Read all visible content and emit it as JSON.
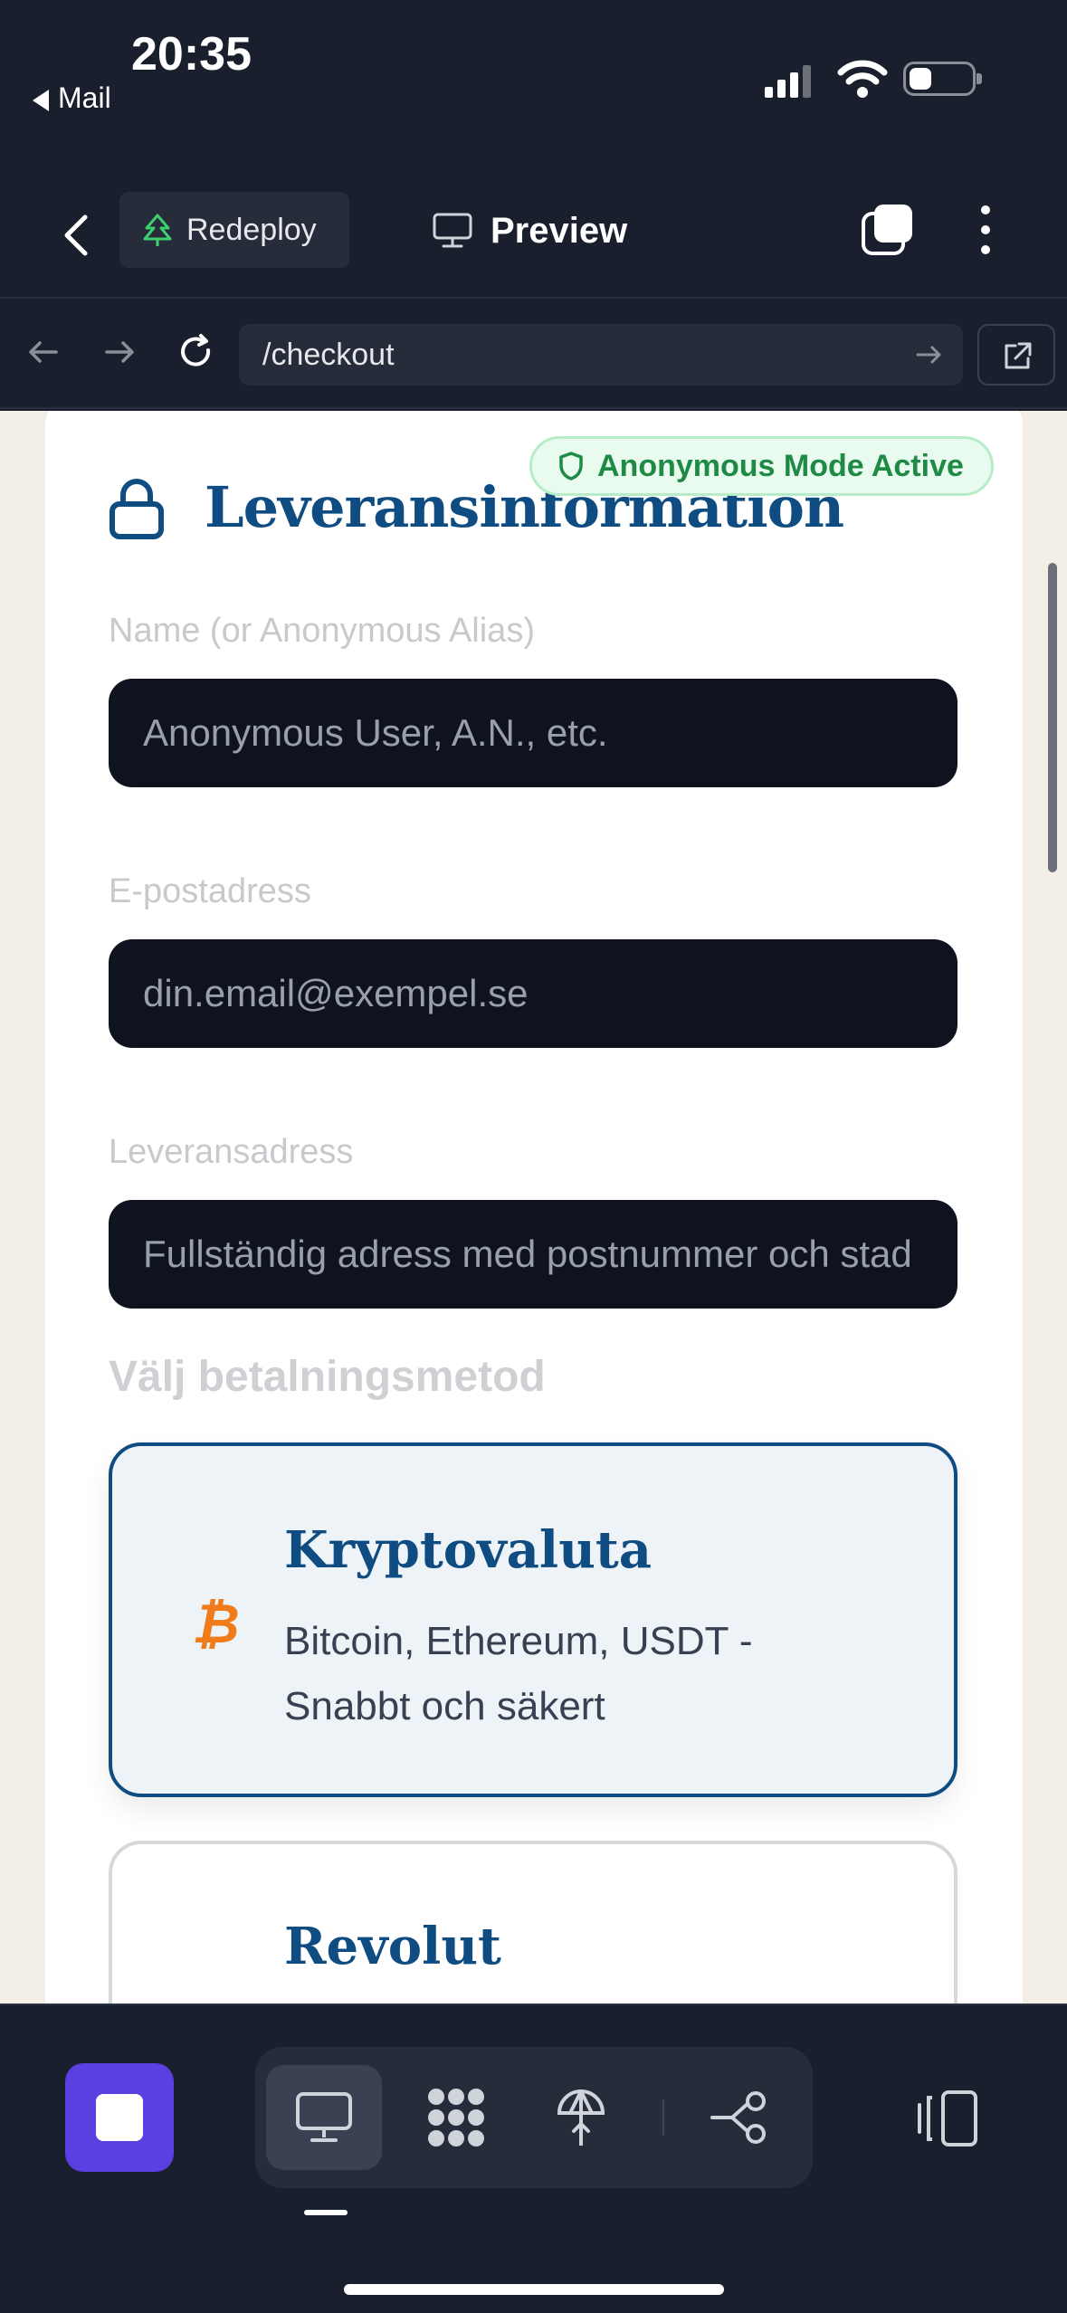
{
  "status_bar": {
    "time": "20:35",
    "back_app": "Mail"
  },
  "app_header": {
    "redeploy_label": "Redeploy",
    "preview_label": "Preview"
  },
  "url_bar": {
    "path": "/checkout"
  },
  "form": {
    "heading": "Leveransinformation",
    "badge": "Anonymous Mode Active",
    "fields": [
      {
        "label": "Name (or Anonymous Alias)",
        "placeholder": "Anonymous User, A.N., etc."
      },
      {
        "label": "E-postadress",
        "placeholder": "din.email@exempel.se"
      },
      {
        "label": "Leveransadress",
        "placeholder": "Fullständig adress med postnummer och stad"
      }
    ],
    "payment_title": "Välj betalningsmetod",
    "payment_options": [
      {
        "icon": "bitcoin-icon",
        "glyph": "₿",
        "name": "Kryptovaluta",
        "description": "Bitcoin, Ethereum, USDT - Snabbt och säkert",
        "selected": true
      },
      {
        "name": "Revolut",
        "selected": false
      }
    ]
  },
  "colors": {
    "accent": "#0f4c81",
    "badge_green": "#1f8a46",
    "bitcoin_orange": "#f07b1a",
    "stop_purple": "#5b3fe0",
    "chrome_bg": "#1a1f2e",
    "page_bg": "#f4efe6"
  }
}
